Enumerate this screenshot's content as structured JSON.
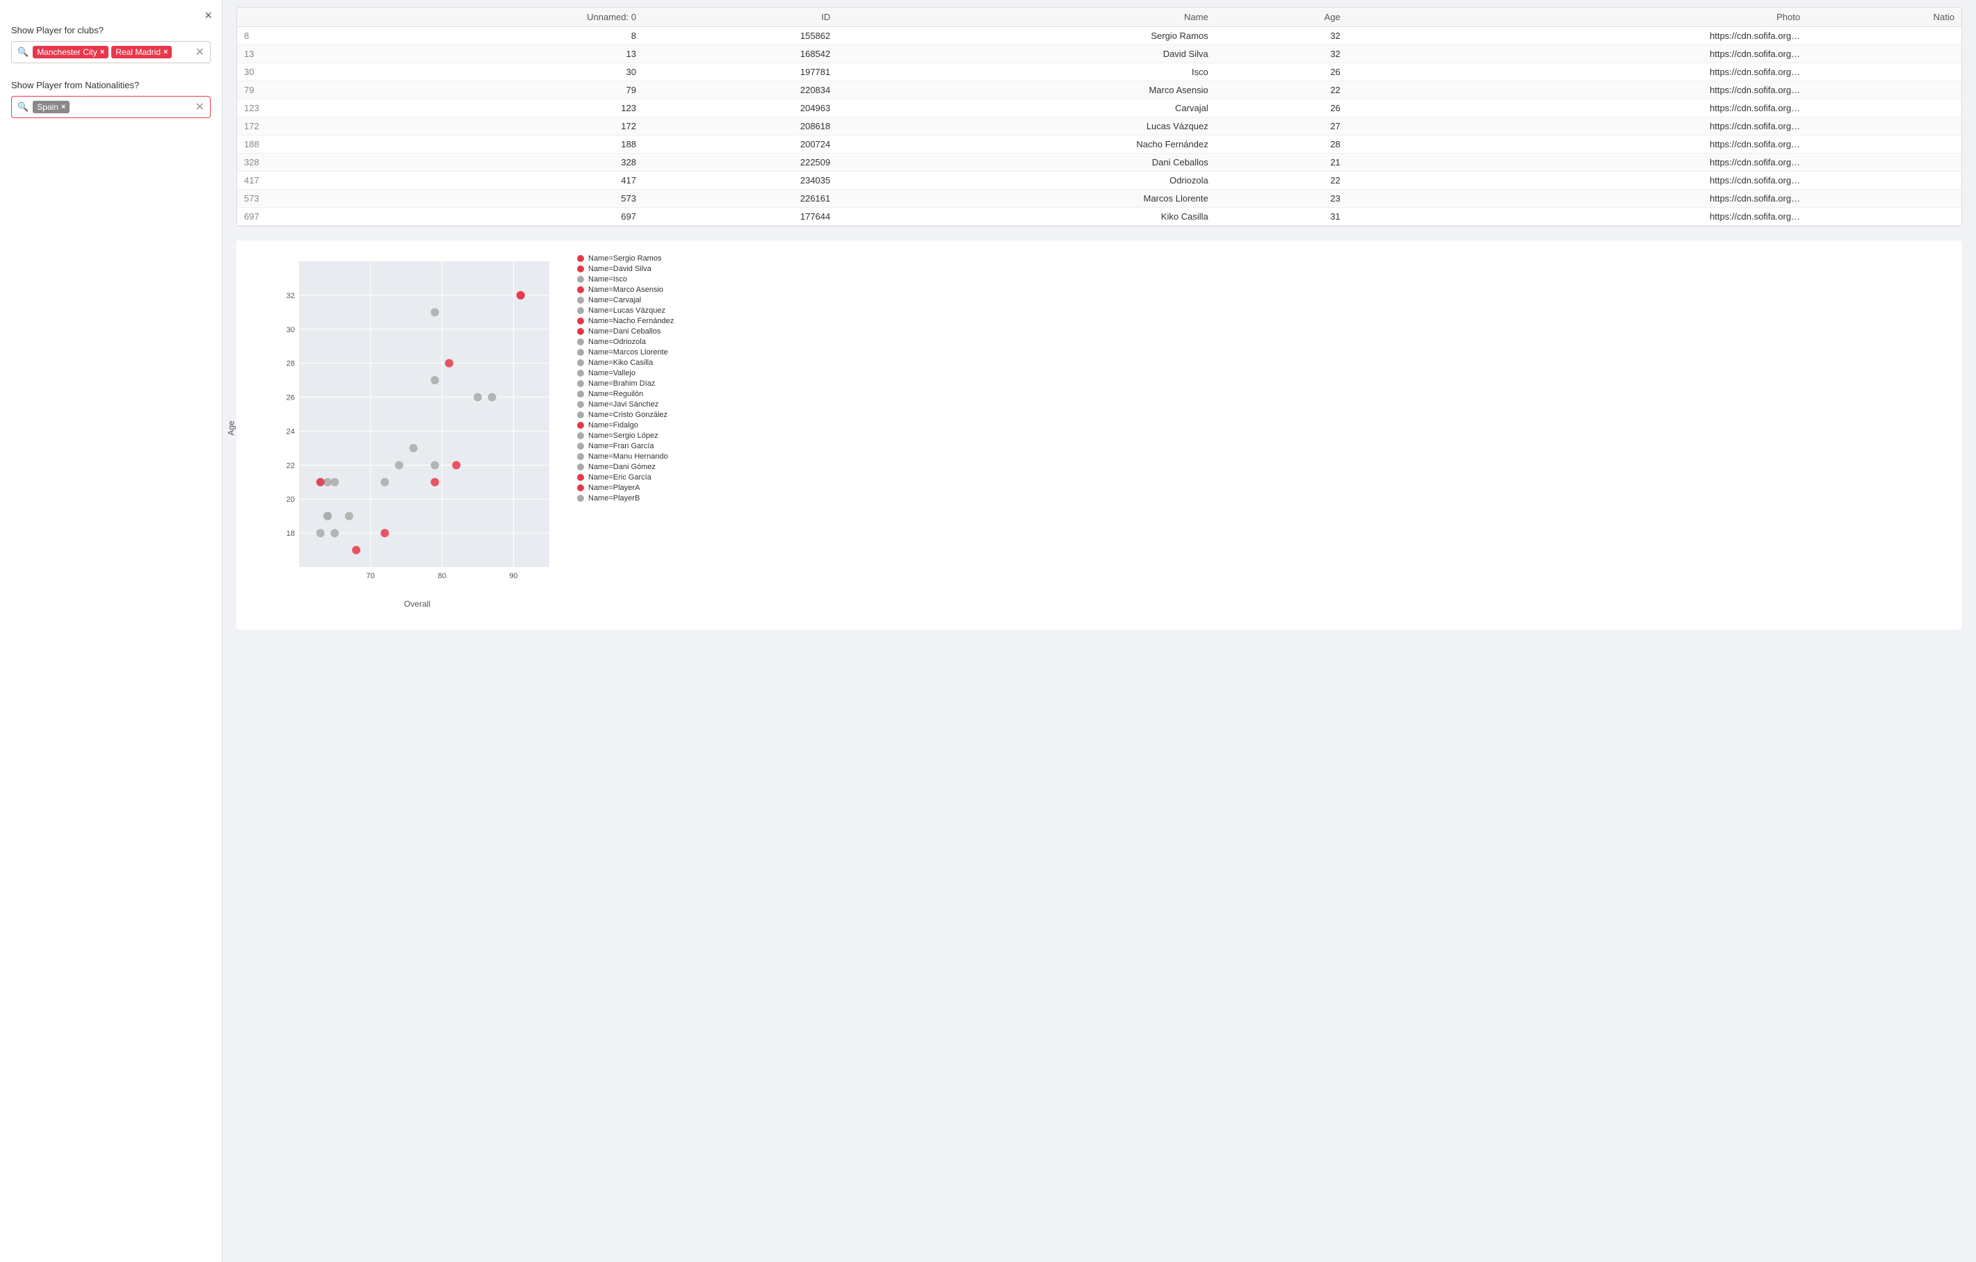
{
  "leftPanel": {
    "close_label": "×",
    "clubs_section_label": "Show Player for clubs?",
    "clubs_tags": [
      {
        "label": "Manchester City",
        "color": "red"
      },
      {
        "label": "Real Madrid",
        "color": "red"
      }
    ],
    "nationalities_section_label": "Show Player from Nationalities?",
    "nationalities_tags": [
      {
        "label": "Spain",
        "color": "grey"
      }
    ]
  },
  "table": {
    "columns": [
      "Unnamed: 0",
      "ID",
      "Name",
      "Age",
      "Photo",
      "Natio"
    ],
    "rows": [
      {
        "idx": "8",
        "unnamed": "8",
        "id": "155862",
        "name": "Sergio Ramos",
        "age": "32",
        "photo": "https://cdn.sofifa.org…",
        "nation": ""
      },
      {
        "idx": "13",
        "unnamed": "13",
        "id": "168542",
        "name": "David Silva",
        "age": "32",
        "photo": "https://cdn.sofifa.org…",
        "nation": ""
      },
      {
        "idx": "30",
        "unnamed": "30",
        "id": "197781",
        "name": "Isco",
        "age": "26",
        "photo": "https://cdn.sofifa.org…",
        "nation": ""
      },
      {
        "idx": "79",
        "unnamed": "79",
        "id": "220834",
        "name": "Marco Asensio",
        "age": "22",
        "photo": "https://cdn.sofifa.org…",
        "nation": ""
      },
      {
        "idx": "123",
        "unnamed": "123",
        "id": "204963",
        "name": "Carvajal",
        "age": "26",
        "photo": "https://cdn.sofifa.org…",
        "nation": ""
      },
      {
        "idx": "172",
        "unnamed": "172",
        "id": "208618",
        "name": "Lucas Vázquez",
        "age": "27",
        "photo": "https://cdn.sofifa.org…",
        "nation": ""
      },
      {
        "idx": "188",
        "unnamed": "188",
        "id": "200724",
        "name": "Nacho Fernández",
        "age": "28",
        "photo": "https://cdn.sofifa.org…",
        "nation": ""
      },
      {
        "idx": "328",
        "unnamed": "328",
        "id": "222509",
        "name": "Dani Ceballos",
        "age": "21",
        "photo": "https://cdn.sofifa.org…",
        "nation": ""
      },
      {
        "idx": "417",
        "unnamed": "417",
        "id": "234035",
        "name": "Odriozola",
        "age": "22",
        "photo": "https://cdn.sofifa.org…",
        "nation": ""
      },
      {
        "idx": "573",
        "unnamed": "573",
        "id": "226161",
        "name": "Marcos Llorente",
        "age": "23",
        "photo": "https://cdn.sofifa.org…",
        "nation": ""
      },
      {
        "idx": "697",
        "unnamed": "697",
        "id": "177644",
        "name": "Kiko Casilla",
        "age": "31",
        "photo": "https://cdn.sofifa.org…",
        "nation": ""
      }
    ]
  },
  "chart": {
    "x_label": "Overall",
    "y_label": "Age",
    "x_min": 60,
    "x_max": 95,
    "y_min": 16,
    "y_max": 34,
    "x_ticks": [
      70,
      80,
      90
    ],
    "y_ticks": [
      18,
      20,
      22,
      24,
      26,
      28,
      30,
      32
    ],
    "points": [
      {
        "name": "Sergio Ramos",
        "overall": 91,
        "age": 32,
        "color": "red"
      },
      {
        "name": "David Silva",
        "overall": 91,
        "age": 32,
        "color": "red"
      },
      {
        "name": "Isco",
        "overall": 87,
        "age": 26,
        "color": "grey"
      },
      {
        "name": "Marco Asensio",
        "overall": 82,
        "age": 22,
        "color": "red"
      },
      {
        "name": "Carvajal",
        "overall": 85,
        "age": 26,
        "color": "grey"
      },
      {
        "name": "Lucas Vázquez",
        "overall": 79,
        "age": 27,
        "color": "grey"
      },
      {
        "name": "Nacho Fernández",
        "overall": 81,
        "age": 28,
        "color": "red"
      },
      {
        "name": "Dani Ceballos",
        "overall": 79,
        "age": 21,
        "color": "red"
      },
      {
        "name": "Odriozola",
        "overall": 79,
        "age": 22,
        "color": "grey"
      },
      {
        "name": "Marcos Llorente",
        "overall": 76,
        "age": 23,
        "color": "grey"
      },
      {
        "name": "Kiko Casilla",
        "overall": 79,
        "age": 31,
        "color": "grey"
      },
      {
        "name": "Vallejo",
        "overall": 74,
        "age": 22,
        "color": "grey"
      },
      {
        "name": "Brahim Díaz",
        "overall": 67,
        "age": 19,
        "color": "grey"
      },
      {
        "name": "Reguilón",
        "overall": 65,
        "age": 21,
        "color": "grey"
      },
      {
        "name": "Javi Sánchez",
        "overall": 64,
        "age": 21,
        "color": "grey"
      },
      {
        "name": "Cristo González",
        "overall": 63,
        "age": 21,
        "color": "grey"
      },
      {
        "name": "Fidalgo",
        "overall": 63,
        "age": 21,
        "color": "red"
      },
      {
        "name": "Sergio López",
        "overall": 72,
        "age": 21,
        "color": "grey"
      },
      {
        "name": "Fran García",
        "overall": 64,
        "age": 19,
        "color": "grey"
      },
      {
        "name": "Manu Hernando",
        "overall": 64,
        "age": 19,
        "color": "grey"
      },
      {
        "name": "Dani Gómez",
        "overall": 65,
        "age": 18,
        "color": "grey"
      },
      {
        "name": "Eric García",
        "overall": 72,
        "age": 18,
        "color": "red"
      },
      {
        "name": "PlayerA",
        "overall": 68,
        "age": 17,
        "color": "red"
      },
      {
        "name": "PlayerB",
        "overall": 63,
        "age": 18,
        "color": "grey"
      }
    ]
  }
}
